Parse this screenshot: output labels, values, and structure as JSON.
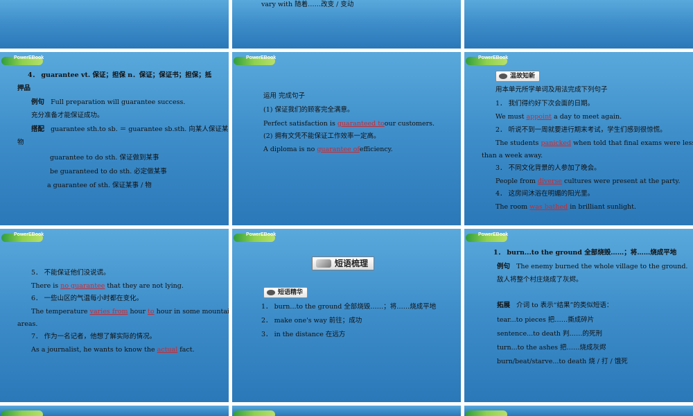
{
  "logo_text": "PowerEBook",
  "top_middle": {
    "line": "vary with  随着……改变 / 变动"
  },
  "guarantee": {
    "heading": "4．  guarantee vt. 保证；担保  n．保证；保证书；担保；抵",
    "heading2": "押品",
    "example_label": "例句",
    "example_en": "Full preparation will guarantee success.",
    "example_cn": "充分准备才能保证成功。",
    "collocation_label": "搭配",
    "collocation_1": "guarantee sth.to sb. ＝ guarantee sb.sth.  向某人保证某",
    "collocation_1b": "物",
    "collocation_2": "guarantee to do sth. 保证做到某事",
    "collocation_3": "be guaranteed to do sth. 必定做某事",
    "collocation_4": "a guarantee of sth. 保证某事 / 物"
  },
  "use": {
    "title": "运用    完成句子",
    "q1_cn": "(1) 保证我们的顾客完全满意。",
    "q1_pre": "Perfect satisfaction is ",
    "q1_ans": "guaranteed to",
    "q1_post": "our customers.",
    "q2_cn": "(2) 拥有文凭不能保证工作效率一定高。",
    "q2_pre": "A diploma is no ",
    "q2_ans": "guarantee of",
    "q2_post": "efficiency."
  },
  "review": {
    "badge": "温故知新",
    "instruction": "用本单元所学单词及用法完成下列句子",
    "q1_cn": "1．  我们得约好下次会面的日期。",
    "q1_pre": "We must ",
    "q1_ans": "appoint",
    "q1_post": " a day to meet again.",
    "q2_cn": "2．  听说不到一周就要进行期末考试，学生们感到很惊慌。",
    "q2_pre": "The students ",
    "q2_ans": "panicked",
    "q2_post": " when told that final exams were less",
    "q2_post2": "than a week away.",
    "q3_cn": "3．  不同文化背景的人参加了晚会。",
    "q3_pre": "People from ",
    "q3_ans": "diverse",
    "q3_post": " cultures were present at the party.",
    "q4_cn": "4．  这房间沐浴在明媚的阳光里。",
    "q4_pre": "The room ",
    "q4_ans": "was bathed",
    "q4_post": " in brilliant sunlight."
  },
  "more": {
    "q5_cn": "5．  不能保证他们没说谎。",
    "q5_pre": "There is ",
    "q5_ans": "no guarantee",
    "q5_post": " that they are not lying.",
    "q6_cn": "6．  一些山区的气温每小时都在变化。",
    "q6_pre": "The temperature ",
    "q6_ans": "varies from",
    "q6_mid": " hour ",
    "q6_ans2": "to",
    "q6_post": " hour in some mountainous",
    "q6_post2": "areas.",
    "q7_cn": "7．  作为一名记者，他想了解实际的情况。",
    "q7_pre": "As a journalist, he wants to know the ",
    "q7_ans": "actual",
    "q7_post": " fact."
  },
  "phrases": {
    "title_badge": "短语梳理",
    "sub_badge": "短语精华",
    "p1": "1．  burn...to the ground    全部烧毁……；将……烧成平地",
    "p2": "2．  make one's way  前往；成功",
    "p3": "3．  in the distance    在远方"
  },
  "burn": {
    "heading": "1．  burn...to the ground    全部烧毁……；将……烧成平地",
    "example_label": "例句",
    "example_en": "The enemy burned the whole village to the ground.",
    "example_cn": "敌人将整个村庄烧成了灰烬。",
    "ext_label": "拓展",
    "ext_text": "介词    to  表示“结果”的类似短语：",
    "e1": "tear...to pieces   把……撕成碎片",
    "e2": "sentence...to death   判……的死刑",
    "e3": "turn...to the ashes   把……烧成灰烬",
    "e4": "burn/beat/starve...to death   烧 / 打 / 饿死"
  }
}
